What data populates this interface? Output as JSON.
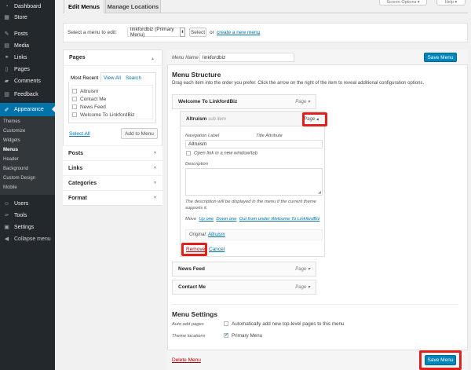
{
  "sidebar": {
    "items": [
      {
        "label": "Dashboard",
        "icon": "dashboard-icon",
        "glyph": "◔"
      },
      {
        "label": "Store",
        "icon": "store-icon",
        "glyph": "▦"
      },
      {
        "label": "Posts",
        "icon": "pin-icon",
        "glyph": "✎"
      },
      {
        "label": "Media",
        "icon": "media-icon",
        "glyph": "▤"
      },
      {
        "label": "Links",
        "icon": "link-icon",
        "glyph": "⚭"
      },
      {
        "label": "Pages",
        "icon": "page-icon",
        "glyph": "▯"
      },
      {
        "label": "Comments",
        "icon": "comment-icon",
        "glyph": "▰"
      },
      {
        "label": "Feedback",
        "icon": "feedback-icon",
        "glyph": "▥"
      },
      {
        "label": "Appearance",
        "icon": "brush-icon",
        "glyph": "✐"
      }
    ],
    "submenu": [
      "Themes",
      "Customize",
      "Widgets",
      "Menus",
      "Header",
      "Background",
      "Custom Design",
      "Mobile"
    ],
    "lower": [
      {
        "label": "Users",
        "icon": "users-icon",
        "glyph": "☺"
      },
      {
        "label": "Tools",
        "icon": "tools-icon",
        "glyph": "✑"
      },
      {
        "label": "Settings",
        "icon": "settings-icon",
        "glyph": "▣"
      },
      {
        "label": "Collapse menu",
        "icon": "collapse-icon",
        "glyph": "◀"
      }
    ]
  },
  "top": {
    "screen_options": "Screen Options",
    "help": "Help",
    "tabs": [
      "Edit Menus",
      "Manage Locations"
    ]
  },
  "select_bar": {
    "label": "Select a menu to edit:",
    "selected": "linkfordbiz (Primary Menu)",
    "select_button": "Select",
    "or_text": "or",
    "create_link": "create a new menu"
  },
  "left_panel": {
    "pages_title": "Pages",
    "tabs": [
      "Most Recent",
      "View All",
      "Search"
    ],
    "pages": [
      "Altruism",
      "Contact Me",
      "News Feed",
      "Welcome To LinkfordBiz"
    ],
    "select_all": "Select All",
    "add_button": "Add to Menu",
    "sections": [
      "Posts",
      "Links",
      "Categories",
      "Format"
    ]
  },
  "menu": {
    "name_label": "Menu Name",
    "name_value": "linkfordbiz",
    "save_label": "Save Menu",
    "structure_title": "Menu Structure",
    "structure_desc": "Drag each item into the order you prefer. Click the arrow on the right of the item to reveal additional configuration options.",
    "page_type": "Page",
    "items": {
      "welcome": "Welcome To LinkfordBiz",
      "altruism": "Altruism",
      "altruism_sub": "sub item",
      "news": "News Feed",
      "contact": "Contact Me"
    },
    "form": {
      "nav_label": "Navigation Label",
      "title_attr": "Title Attribute",
      "nav_value": "Altruism",
      "new_tab": "Open link in a new window/tab",
      "description": "Description",
      "desc_note_1": "The description will be displayed in the menu if the current theme",
      "desc_note_2": "supports it.",
      "move": "Move",
      "up_one": "Up one",
      "down_one": "Down one",
      "out_from": "Out from under Welcome To LinkfordBiz",
      "original": "Original:",
      "original_link": "Altruism",
      "remove": "Remove",
      "cancel": "Cancel"
    },
    "settings": {
      "title": "Menu Settings",
      "auto_label": "Auto add pages",
      "auto_text": "Automatically add new top-level pages to this menu",
      "locations_label": "Theme locations",
      "primary": "Primary Menu"
    },
    "delete": "Delete Menu"
  }
}
